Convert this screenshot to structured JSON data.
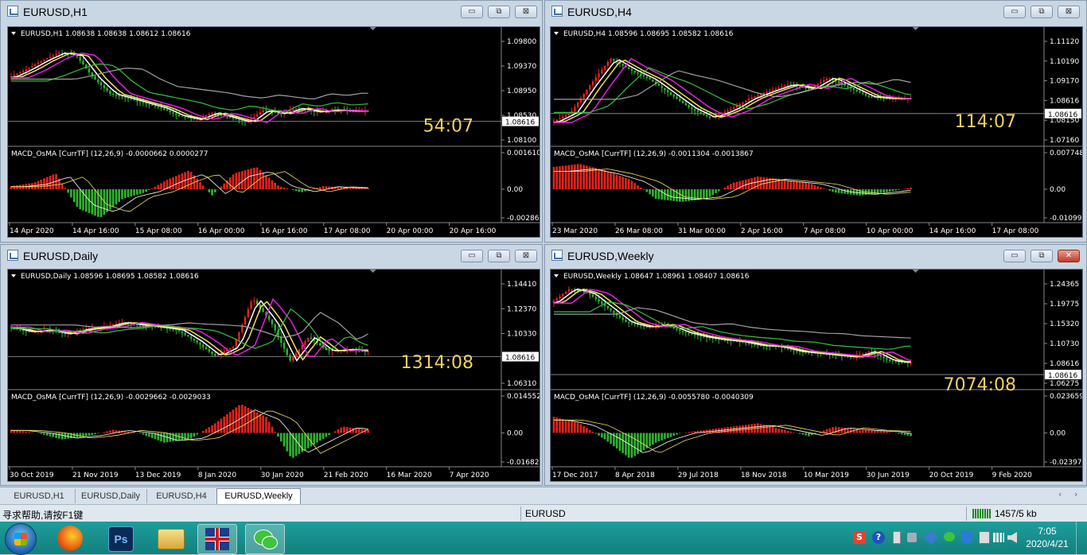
{
  "windows": [
    {
      "id": "h1",
      "title": "EURUSD,H1",
      "header": "EURUSD,H1  1.08638 1.08638 1.08612 1.08616",
      "timer": "54:07",
      "price_ticks": [
        "1.09800",
        "1.09370",
        "1.08950",
        "1.08530",
        "1.08100"
      ],
      "current_price": "1.08616",
      "macd_label": "MACD_OsMA [CurrTF] (12,26,9) -0.0000662 0.0000277",
      "macd_ticks": [
        "0.0016101",
        "0.00",
        "-0.002867"
      ],
      "dates": [
        "14 Apr 2020",
        "14 Apr 16:00",
        "15 Apr 08:00",
        "16 Apr 00:00",
        "16 Apr 16:00",
        "17 Apr 08:00",
        "20 Apr 00:00",
        "20 Apr 16:00"
      ],
      "buttons": {
        "min": "▭",
        "max": "⧉",
        "close": "⊠"
      }
    },
    {
      "id": "h4",
      "title": "EURUSD,H4",
      "header": "EURUSD,H4  1.08596 1.08695 1.08582 1.08616",
      "timer": "114:07",
      "price_ticks": [
        "1.11120",
        "1.10190",
        "1.09170",
        "1.08616",
        "1.08150",
        "1.07160"
      ],
      "current_price": "1.08616",
      "macd_label": "MACD_OsMA [CurrTF] (12,26,9) -0.0011304 -0.0013867",
      "macd_ticks": [
        "0.0077482",
        "0.00",
        "-0.010999"
      ],
      "dates": [
        "23 Mar 2020",
        "26 Mar 08:00",
        "31 Mar 00:00",
        "2 Apr 16:00",
        "7 Apr 08:00",
        "10 Apr 00:00",
        "14 Apr 16:00",
        "17 Apr 08:00"
      ],
      "buttons": {
        "min": "▭",
        "max": "⧉",
        "close": "⊠"
      }
    },
    {
      "id": "daily",
      "title": "EURUSD,Daily",
      "header": "EURUSD,Daily  1.08596 1.08695 1.08582 1.08616",
      "timer": "1314:08",
      "price_ticks": [
        "1.14410",
        "1.12370",
        "1.10330",
        "1.08290",
        "1.06310"
      ],
      "current_price": "1.08616",
      "macd_label": "MACD_OsMA [CurrTF] (12,26,9) -0.0029662 -0.0029033",
      "macd_ticks": [
        "0.0145521",
        "0.00",
        "-0.016826"
      ],
      "dates": [
        "30 Oct 2019",
        "21 Nov 2019",
        "13 Dec 2019",
        "8 Jan 2020",
        "30 Jan 2020",
        "21 Feb 2020",
        "16 Mar 2020",
        "7 Apr 2020"
      ],
      "buttons": {
        "min": "▭",
        "max": "⧉",
        "close": "⊠"
      }
    },
    {
      "id": "weekly",
      "title": "EURUSD,Weekly",
      "header": "EURUSD,Weekly  1.08647 1.08961 1.08407 1.08616",
      "timer": "7074:08",
      "price_ticks": [
        "1.24365",
        "1.19775",
        "1.15320",
        "1.10730",
        "1.08616",
        "1.06275"
      ],
      "current_price": "1.08616",
      "macd_label": "MACD_OsMA [CurrTF] (12,26,9) -0.0055780 -0.0040309",
      "macd_ticks": [
        "0.0236597",
        "0.00",
        "-0.023972"
      ],
      "dates": [
        "17 Dec 2017",
        "8 Apr 2018",
        "29 Jul 2018",
        "18 Nov 2018",
        "10 Mar 2019",
        "30 Jun 2019",
        "20 Oct 2019",
        "9 Feb 2020"
      ],
      "buttons": {
        "min": "▭",
        "max": "⧉",
        "close": "✕"
      }
    }
  ],
  "tabs": [
    "EURUSD,H1",
    "EURUSD,Daily",
    "EURUSD,H4",
    "EURUSD,Weekly"
  ],
  "active_tab": "EURUSD,Weekly",
  "status": {
    "help": "寻求帮助,请按F1键",
    "symbol": "EURUSD",
    "traffic": "1457/5 kb"
  },
  "clock": {
    "time": "7:05",
    "date": "2020/4/21"
  },
  "colors": {
    "bull": "#e8221a",
    "bear": "#2fb52f",
    "ma_white": "#ffffff",
    "ma_yellow": "#f5e05a",
    "ma_magenta": "#e020e0",
    "ma_green": "#38c038",
    "ma_gray": "#a0a0a0",
    "timer": "#f0d060"
  }
}
